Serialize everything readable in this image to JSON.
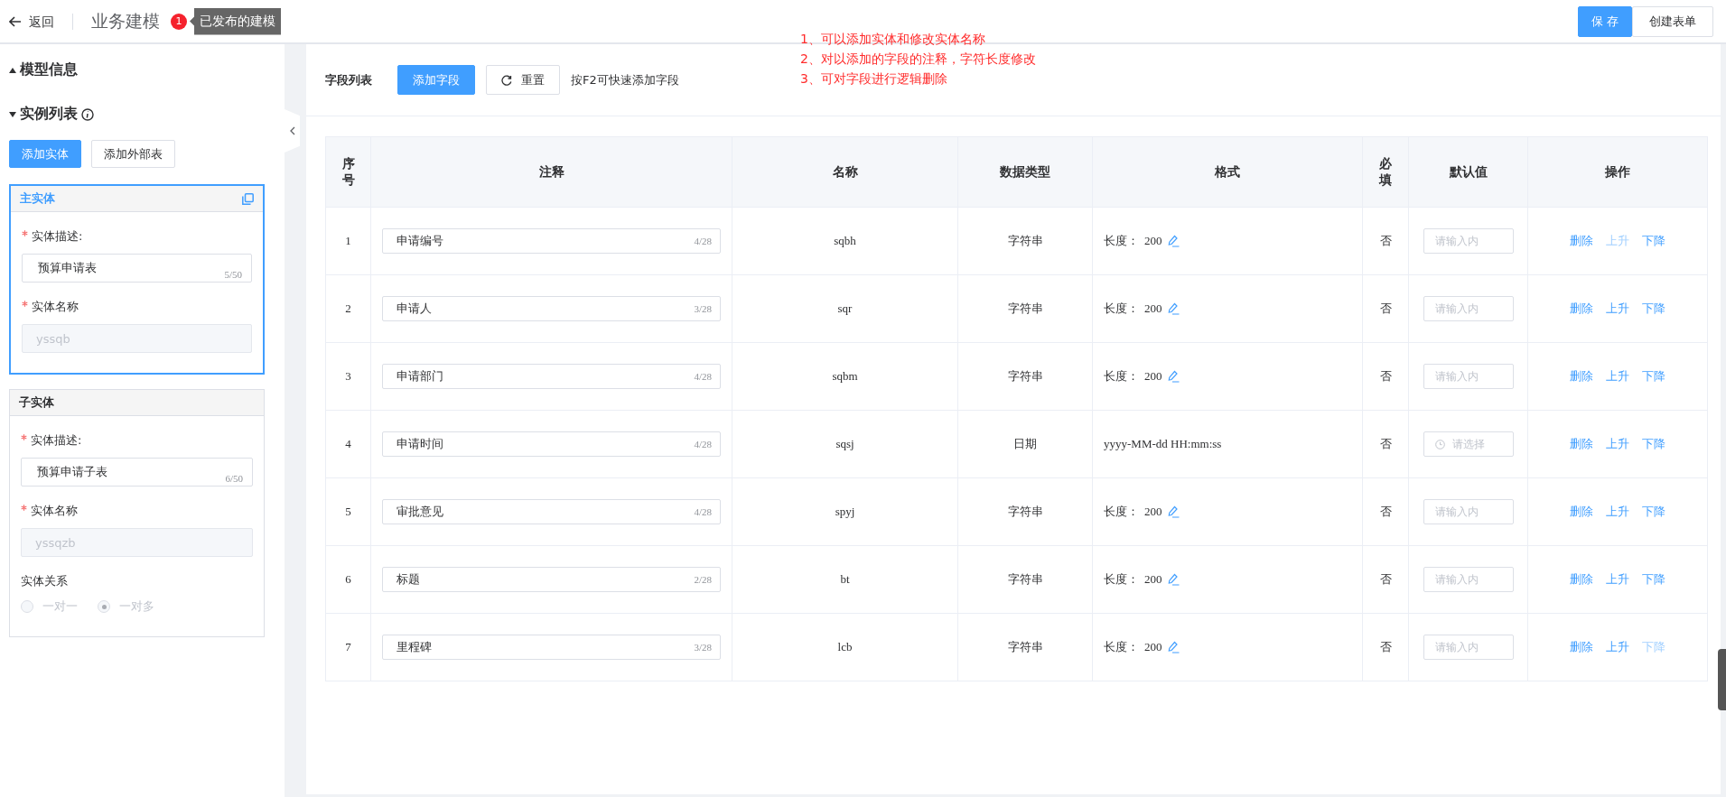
{
  "header": {
    "back_label": "返回",
    "title": "业务建模",
    "badge": "1",
    "tooltip": "已发布的建模",
    "buttons": [
      {
        "label": "保 存",
        "kind": "primary"
      },
      {
        "label": "创建表单",
        "kind": "default"
      }
    ]
  },
  "annotation": [
    "1、可以添加实体和修改实体名称",
    "2、对以添加的字段的注释，字符长度修改",
    "3、可对字段进行逻辑删除"
  ],
  "sidebar": {
    "sections": [
      {
        "label": "模型信息",
        "expanded": false,
        "info": false
      },
      {
        "label": "实例列表",
        "expanded": true,
        "info": true
      }
    ],
    "buttons": [
      {
        "label": "添加实体",
        "kind": "primary"
      },
      {
        "label": "添加外部表",
        "kind": "default"
      }
    ],
    "entities": [
      {
        "title": "主实体",
        "selected": true,
        "copyable": true,
        "fields": [
          {
            "kind": "textarea",
            "label": "实体描述:",
            "required": true,
            "value": "预算申请表",
            "count": "5/50"
          },
          {
            "kind": "input",
            "label": "实体名称",
            "required": true,
            "value": "yssqb",
            "disabled": true
          }
        ]
      },
      {
        "title": "子实体",
        "selected": false,
        "copyable": false,
        "fields": [
          {
            "kind": "textarea",
            "label": "实体描述:",
            "required": true,
            "value": "预算申请子表",
            "count": "6/50"
          },
          {
            "kind": "input",
            "label": "实体名称",
            "required": true,
            "value": "yssqzb",
            "disabled": true
          },
          {
            "kind": "radio",
            "label": "实体关系",
            "required": false,
            "disabled": true,
            "options": [
              {
                "label": "一对一",
                "selected": false
              },
              {
                "label": "一对多",
                "selected": true
              }
            ]
          }
        ]
      }
    ]
  },
  "toolbar": {
    "title": "字段列表",
    "buttons": [
      {
        "label": "添加字段",
        "kind": "primary"
      },
      {
        "label": "重置",
        "kind": "reset"
      }
    ],
    "hint": "按F2可快速添加字段"
  },
  "table": {
    "columns": [
      "序号",
      "注释",
      "名称",
      "数据类型",
      "格式",
      "必填",
      "默认值",
      "操作"
    ],
    "rows": [
      {
        "index": "1",
        "comment": "申请编号",
        "count": "4/28",
        "name": "sqbh",
        "type": "字符串",
        "format": {
          "kind": "length",
          "label": "长度：",
          "value": "200"
        },
        "required": "否",
        "default": {
          "kind": "input",
          "placeholder": "请输入内"
        },
        "actions": [
          {
            "label": "删除",
            "disabled": false
          },
          {
            "label": "上升",
            "disabled": true
          },
          {
            "label": "下降",
            "disabled": false
          }
        ]
      },
      {
        "index": "2",
        "comment": "申请人",
        "count": "3/28",
        "name": "sqr",
        "type": "字符串",
        "format": {
          "kind": "length",
          "label": "长度：",
          "value": "200"
        },
        "required": "否",
        "default": {
          "kind": "input",
          "placeholder": "请输入内"
        },
        "actions": [
          {
            "label": "删除",
            "disabled": false
          },
          {
            "label": "上升",
            "disabled": false
          },
          {
            "label": "下降",
            "disabled": false
          }
        ]
      },
      {
        "index": "3",
        "comment": "申请部门",
        "count": "4/28",
        "name": "sqbm",
        "type": "字符串",
        "format": {
          "kind": "length",
          "label": "长度：",
          "value": "200"
        },
        "required": "否",
        "default": {
          "kind": "input",
          "placeholder": "请输入内"
        },
        "actions": [
          {
            "label": "删除",
            "disabled": false
          },
          {
            "label": "上升",
            "disabled": false
          },
          {
            "label": "下降",
            "disabled": false
          }
        ]
      },
      {
        "index": "4",
        "comment": "申请时间",
        "count": "4/28",
        "name": "sqsj",
        "type": "日期",
        "format": {
          "kind": "pattern",
          "value": "yyyy-MM-dd HH:mm:ss"
        },
        "required": "否",
        "default": {
          "kind": "time",
          "placeholder": "请选择"
        },
        "actions": [
          {
            "label": "删除",
            "disabled": false
          },
          {
            "label": "上升",
            "disabled": false
          },
          {
            "label": "下降",
            "disabled": false
          }
        ]
      },
      {
        "index": "5",
        "comment": "审批意见",
        "count": "4/28",
        "name": "spyj",
        "type": "字符串",
        "format": {
          "kind": "length",
          "label": "长度：",
          "value": "200"
        },
        "required": "否",
        "default": {
          "kind": "input",
          "placeholder": "请输入内"
        },
        "actions": [
          {
            "label": "删除",
            "disabled": false
          },
          {
            "label": "上升",
            "disabled": false
          },
          {
            "label": "下降",
            "disabled": false
          }
        ]
      },
      {
        "index": "6",
        "comment": "标题",
        "count": "2/28",
        "name": "bt",
        "type": "字符串",
        "format": {
          "kind": "length",
          "label": "长度：",
          "value": "200"
        },
        "required": "否",
        "default": {
          "kind": "input",
          "placeholder": "请输入内"
        },
        "actions": [
          {
            "label": "删除",
            "disabled": false
          },
          {
            "label": "上升",
            "disabled": false
          },
          {
            "label": "下降",
            "disabled": false
          }
        ]
      },
      {
        "index": "7",
        "comment": "里程碑",
        "count": "3/28",
        "name": "lcb",
        "type": "字符串",
        "format": {
          "kind": "length",
          "label": "长度：",
          "value": "200"
        },
        "required": "否",
        "default": {
          "kind": "input",
          "placeholder": "请输入内"
        },
        "actions": [
          {
            "label": "删除",
            "disabled": false
          },
          {
            "label": "上升",
            "disabled": false
          },
          {
            "label": "下降",
            "disabled": true
          }
        ]
      }
    ]
  }
}
